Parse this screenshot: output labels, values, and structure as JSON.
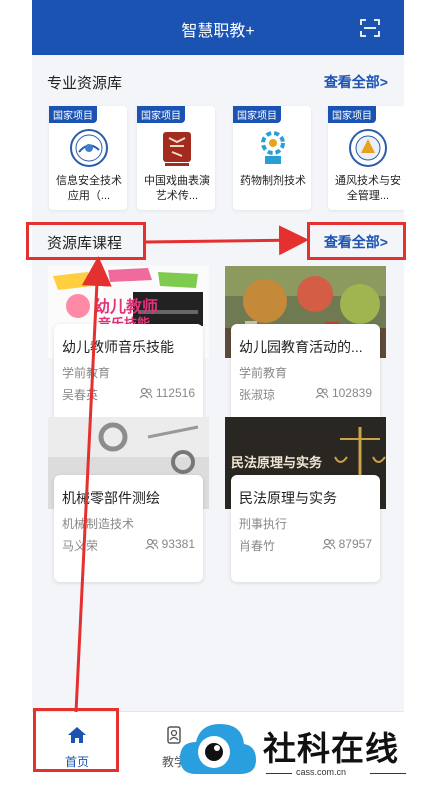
{
  "app": {
    "title": "智慧职教+"
  },
  "resources": {
    "title": "专业资源库",
    "see_all": "查看全部>",
    "items": [
      {
        "tag": "国家项目",
        "name": "信息安全技术应用（..."
      },
      {
        "tag": "国家项目",
        "name": "中国戏曲表演艺术传..."
      },
      {
        "tag": "国家项目",
        "name": "药物制剂技术"
      },
      {
        "tag": "国家项目",
        "name": "通风技术与安全管理..."
      }
    ]
  },
  "courses": {
    "title": "资源库课程",
    "see_all": "查看全部>",
    "items": [
      {
        "name": "幼儿教师音乐技能",
        "category": "学前教育",
        "teacher": "吴春英",
        "views": "112516"
      },
      {
        "name": "幼儿园教育活动的...",
        "category": "学前教育",
        "teacher": "张淑琼",
        "views": "102839"
      },
      {
        "name": "机械零部件测绘",
        "category": "机械制造技术",
        "teacher": "马义荣",
        "views": "93381"
      },
      {
        "name": "民法原理与实务",
        "category": "刑事执行",
        "teacher": "肖春竹",
        "views": "87957"
      }
    ],
    "thumb_text": {
      "music_top": "幼儿教师",
      "music_bottom": "音乐技能",
      "law": "民法原理与实务"
    }
  },
  "nav": {
    "home": "首页",
    "teach": "教学"
  },
  "watermark": {
    "text": "社科在线",
    "url": "cass.com.cn"
  },
  "colors": {
    "primary": "#1b53b3",
    "annotation": "#e53030"
  }
}
